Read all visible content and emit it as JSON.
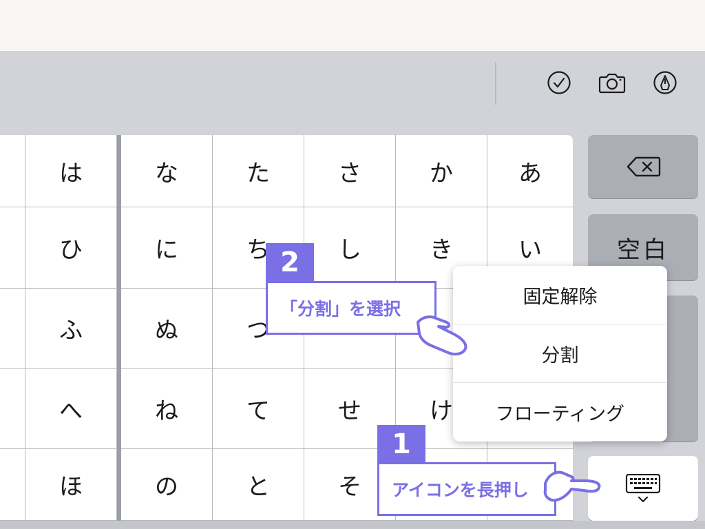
{
  "toolbar": {
    "icons": [
      "checkmark-circle-icon",
      "camera-icon",
      "pen-tip-icon"
    ]
  },
  "keyboard": {
    "rows": [
      [
        "は",
        "な",
        "た",
        "さ",
        "か",
        "あ"
      ],
      [
        "ひ",
        "に",
        "ち",
        "し",
        "き",
        "い"
      ],
      [
        "ふ",
        "ぬ",
        "つ",
        "",
        "",
        ""
      ],
      [
        "へ",
        "ね",
        "て",
        "せ",
        "け",
        ""
      ],
      [
        "ほ",
        "の",
        "と",
        "そ",
        "",
        ""
      ]
    ],
    "delete_icon": "delete-backspace-icon",
    "space_label": "空白",
    "keyboard_icon": "keyboard-hide-icon"
  },
  "menu": {
    "items": [
      "固定解除",
      "分割",
      "フローティング"
    ]
  },
  "callouts": [
    {
      "number": "1",
      "text": "アイコンを長押し"
    },
    {
      "number": "2",
      "text": "「分割」を選択"
    }
  ],
  "colors": {
    "accent": "#7b6fe6",
    "keyboard_bg": "#d1d3d9",
    "special_key": "#acaeb6"
  }
}
